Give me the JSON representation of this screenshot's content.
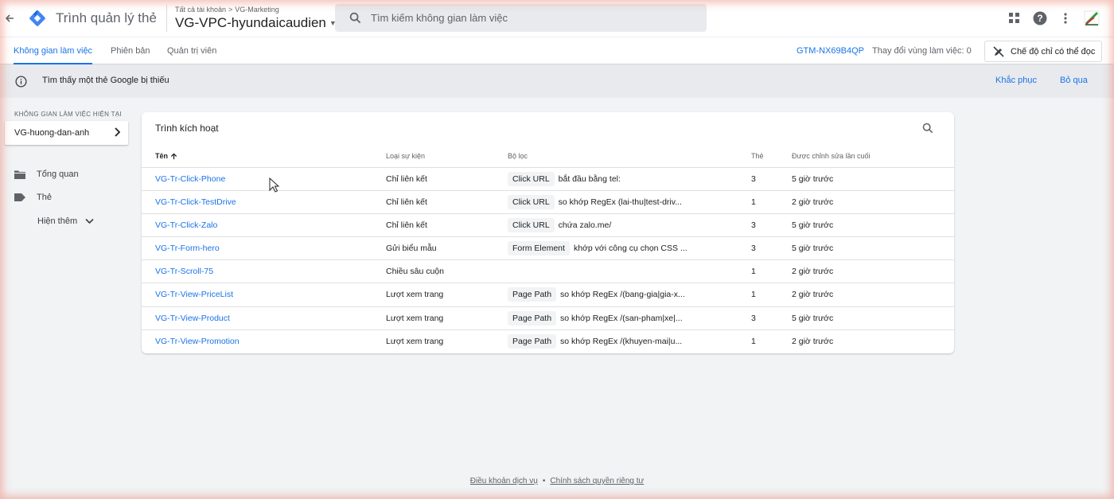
{
  "app": {
    "title": "Trình quản lý thẻ",
    "breadcrumb": {
      "all_accounts": "Tất cả tài khoản",
      "separator": ">",
      "account": "VG-Marketing"
    },
    "container_name": "VG-VPC-hyundaicaudien",
    "search_placeholder": "Tìm kiếm không gian làm việc"
  },
  "icons": {
    "back": "back-arrow-icon",
    "logo": "tag-manager-logo",
    "search": "search-icon",
    "apps": "apps-grid-icon",
    "help": "help-icon",
    "more": "more-vert-icon",
    "profile": "profile-logo"
  },
  "tabs": [
    {
      "label": "Không gian làm việc",
      "active": true
    },
    {
      "label": "Phiên bản",
      "active": false
    },
    {
      "label": "Quản trị viên",
      "active": false
    }
  ],
  "header_right": {
    "container_id": "GTM-NX69B4QP",
    "workspace_changes": "Thay đổi vùng làm việc: 0",
    "read_only_label": "Chế độ chỉ có thể đọc"
  },
  "notice": {
    "text": "Tìm thấy một thẻ Google bị thiếu",
    "fix_label": "Khắc phục",
    "skip_label": "Bỏ qua"
  },
  "sidebar": {
    "workspace_label": "KHÔNG GIAN LÀM VIỆC HIỆN TẠI",
    "workspace_name": "VG-huong-dan-anh",
    "items": [
      {
        "label": "Tổng quan",
        "icon": "folder-icon"
      },
      {
        "label": "Thẻ",
        "icon": "tag-icon"
      }
    ],
    "more_label": "Hiện thêm"
  },
  "triggers": {
    "title": "Trình kích hoạt",
    "columns": {
      "name": "Tên",
      "event_type": "Loại sự kiện",
      "filter": "Bộ lọc",
      "tags": "Thẻ",
      "last_edited": "Được chỉnh sửa lần cuối"
    },
    "rows": [
      {
        "name": "VG-Tr-Click-Phone",
        "event": "Chỉ liên kết",
        "filter_var": "Click URL",
        "filter_cond": "bắt đầu bằng tel:",
        "tags": "3",
        "edited": "5 giờ trước"
      },
      {
        "name": "VG-Tr-Click-TestDrive",
        "event": "Chỉ liên kết",
        "filter_var": "Click URL",
        "filter_cond": "so khớp RegEx (lai-thu|test-driv...",
        "tags": "1",
        "edited": "2 giờ trước"
      },
      {
        "name": "VG-Tr-Click-Zalo",
        "event": "Chỉ liên kết",
        "filter_var": "Click URL",
        "filter_cond": "chứa zalo.me/",
        "tags": "3",
        "edited": "5 giờ trước"
      },
      {
        "name": "VG-Tr-Form-hero",
        "event": "Gửi biểu mẫu",
        "filter_var": "Form Element",
        "filter_cond": "khớp với công cụ chọn CSS ...",
        "tags": "3",
        "edited": "5 giờ trước"
      },
      {
        "name": "VG-Tr-Scroll-75",
        "event": "Chiều sâu cuộn",
        "filter_var": "",
        "filter_cond": "",
        "tags": "1",
        "edited": "2 giờ trước"
      },
      {
        "name": "VG-Tr-View-PriceList",
        "event": "Lượt xem trang",
        "filter_var": "Page Path",
        "filter_cond": "so khớp RegEx /(bang-gia|gia-x...",
        "tags": "1",
        "edited": "2 giờ trước"
      },
      {
        "name": "VG-Tr-View-Product",
        "event": "Lượt xem trang",
        "filter_var": "Page Path",
        "filter_cond": "so khớp RegEx /(san-pham|xe|...",
        "tags": "3",
        "edited": "5 giờ trước"
      },
      {
        "name": "VG-Tr-View-Promotion",
        "event": "Lượt xem trang",
        "filter_var": "Page Path",
        "filter_cond": "so khớp RegEx /(khuyen-mai|u...",
        "tags": "1",
        "edited": "2 giờ trước"
      }
    ]
  },
  "footer": {
    "terms": "Điều khoản dịch vụ",
    "dot": "•",
    "privacy": "Chính sách quyền riêng tư"
  },
  "colors": {
    "accent": "#1a73e8",
    "logo_blue": "#4285f4",
    "logo_dark": "#1967d2"
  }
}
